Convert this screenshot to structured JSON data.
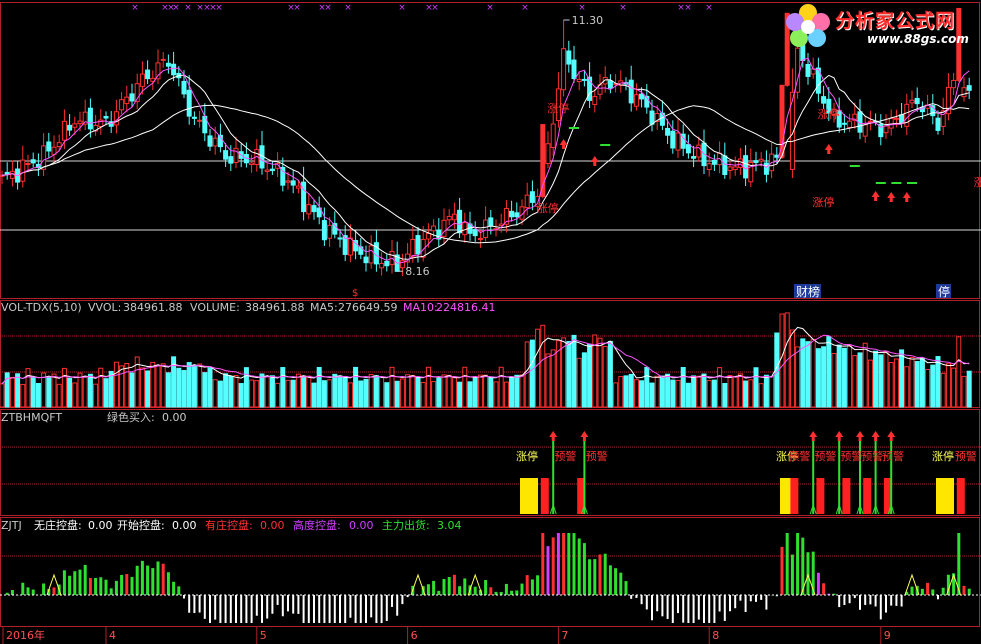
{
  "chart_data": {
    "type": "candlestick",
    "price_panel": {
      "high_label": "11.30",
      "low_label": "8.16",
      "limit_up_label": "涨停",
      "signal_text": "停",
      "finance_tag": "财",
      "list_tag": "榜",
      "pause_tag": "停"
    },
    "volume_panel": {
      "name": "VOL-TDX(5,10)",
      "vvol_label": "VVOL:",
      "vvol_value": "384961.88",
      "volume_label": "VOLUME:",
      "volume_value": "384961.88",
      "ma5_label": "MA5:",
      "ma5_value": "276649.59",
      "ma10_label": "MA10:",
      "ma10_value": "224816.41"
    },
    "signal_panel": {
      "name": "ZTBHMQFT",
      "buy_label": "绿色买入:",
      "buy_value": "0.00",
      "limit_up_label": "涨停",
      "warning_label": "预警"
    },
    "control_panel": {
      "name": "ZJTJ",
      "items": [
        {
          "label": "无庄控盘:",
          "value": "0.00",
          "color": "#ffffff"
        },
        {
          "label": "开始控盘:",
          "value": "0.00",
          "color": "#ffffff"
        },
        {
          "label": "有庄控盘:",
          "value": "0.00",
          "color": "#ff3030"
        },
        {
          "label": "高度控盘:",
          "value": "0.00",
          "color": "#d040ff"
        },
        {
          "label": "主力出货:",
          "value": "3.04",
          "color": "#30e030"
        }
      ]
    },
    "x_axis": {
      "labels": [
        "2016年",
        "4",
        "5",
        "6",
        "7",
        "8",
        "9"
      ]
    },
    "colors": {
      "up": "#ff3030",
      "down": "#54ffff",
      "ma_short": "#ffffff",
      "ma_mid": "#ffff55",
      "ma_long": "#ff55ff",
      "grid": "#b0202a"
    }
  },
  "logo": {
    "title": "分析家公式网",
    "url": "www.88gs.com"
  }
}
